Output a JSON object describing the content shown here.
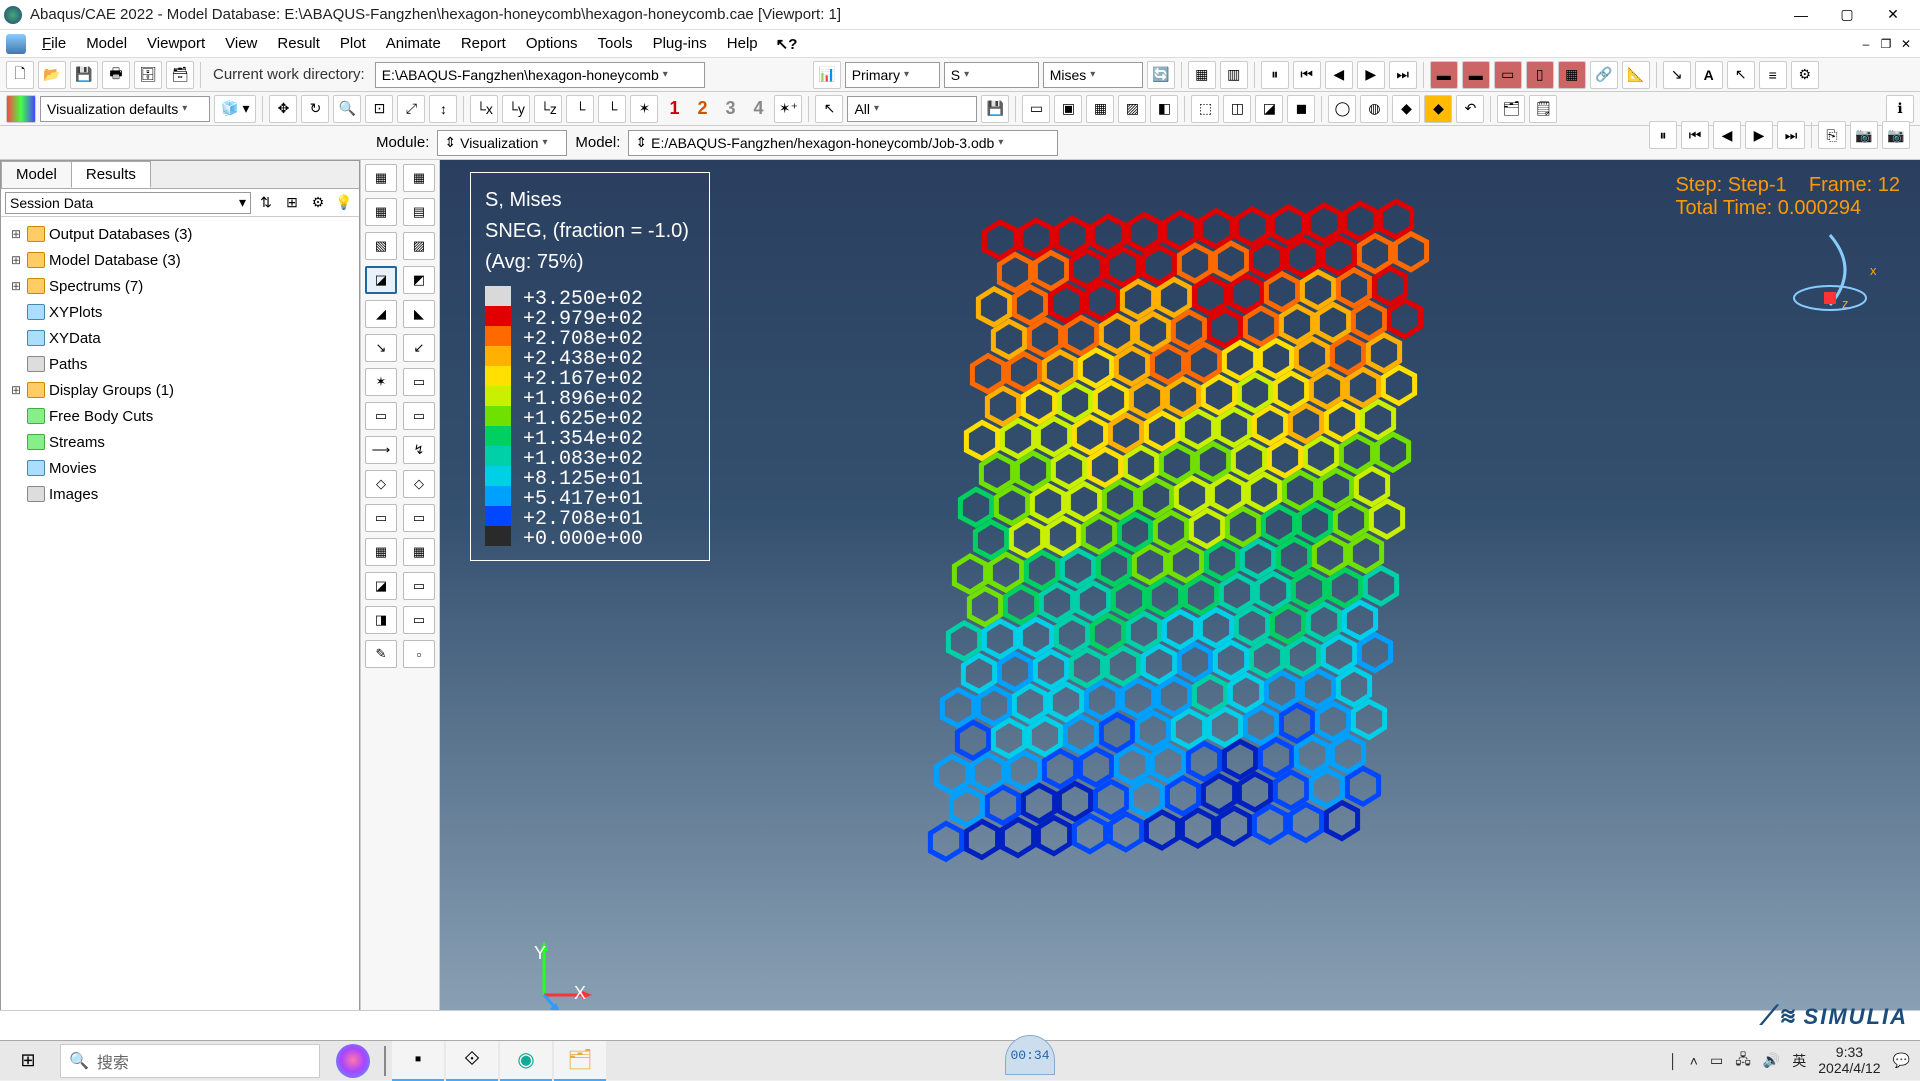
{
  "window": {
    "title": "Abaqus/CAE 2022 - Model Database: E:\\ABAQUS-Fangzhen\\hexagon-honeycomb\\hexagon-honeycomb.cae [Viewport: 1]"
  },
  "menu": {
    "items": [
      "File",
      "Model",
      "Viewport",
      "View",
      "Result",
      "Plot",
      "Animate",
      "Report",
      "Options",
      "Tools",
      "Plug-ins",
      "Help"
    ],
    "help_pointer": "⭢?"
  },
  "toolbar1": {
    "cwd_label": "Current work directory:",
    "cwd_value": "E:\\ABAQUS-Fangzhen\\hexagon-honeycomb",
    "field_scope": "Primary",
    "field_var": "S",
    "field_invariant": "Mises"
  },
  "toolbar2": {
    "viz_label": "Visualization defaults",
    "selection_label": "All",
    "numbered_views": [
      "1",
      "2",
      "3",
      "4"
    ]
  },
  "modulebar": {
    "module_label": "Module:",
    "module_value": "Visualization",
    "model_label": "Model:",
    "model_value": "E:/ABAQUS-Fangzhen/hexagon-honeycomb/Job-3.odb"
  },
  "tree_tabs": {
    "model": "Model",
    "results": "Results"
  },
  "session_data": "Session Data",
  "tree_nodes": [
    {
      "exp": "⊞",
      "icon": "yellow",
      "label": "Output Databases (3)"
    },
    {
      "exp": "⊞",
      "icon": "yellow",
      "label": "Model Database (3)"
    },
    {
      "exp": "⊞",
      "icon": "yellow",
      "label": "Spectrums (7)"
    },
    {
      "exp": "",
      "icon": "blue",
      "label": "XYPlots"
    },
    {
      "exp": "",
      "icon": "blue",
      "label": "XYData"
    },
    {
      "exp": "",
      "icon": "gray",
      "label": "Paths"
    },
    {
      "exp": "⊞",
      "icon": "yellow",
      "label": "Display Groups (1)"
    },
    {
      "exp": "",
      "icon": "green",
      "label": "Free Body Cuts"
    },
    {
      "exp": "",
      "icon": "green",
      "label": "Streams"
    },
    {
      "exp": "",
      "icon": "blue",
      "label": "Movies"
    },
    {
      "exp": "",
      "icon": "gray",
      "label": "Images"
    }
  ],
  "legend": {
    "line1": "S, Mises",
    "line2": "SNEG, (fraction = -1.0)",
    "line3": "(Avg: 75%)",
    "values": [
      "+3.250e+02",
      "+2.979e+02",
      "+2.708e+02",
      "+2.438e+02",
      "+2.167e+02",
      "+1.896e+02",
      "+1.625e+02",
      "+1.354e+02",
      "+1.083e+02",
      "+8.125e+01",
      "+5.417e+01",
      "+2.708e+01",
      "+0.000e+00"
    ],
    "colors": [
      "#d9d9d9",
      "#e00000",
      "#ff6a00",
      "#ffb000",
      "#ffe000",
      "#c8f000",
      "#70e000",
      "#00d060",
      "#00d0a8",
      "#00cfe8",
      "#00a0ff",
      "#0048ff",
      "#2a2a2a"
    ]
  },
  "viewport_status": {
    "line1": "Step: Step-1    Frame: 12",
    "line2": "Total Time: 0.000294"
  },
  "triad": {
    "x": "X",
    "y": "Y",
    "z": "Z"
  },
  "simulia": "SIMULIA",
  "taskbar": {
    "search_placeholder": "搜索",
    "recording": "00:34",
    "ime": "英",
    "time": "9:33",
    "date": "2024/4/12"
  }
}
